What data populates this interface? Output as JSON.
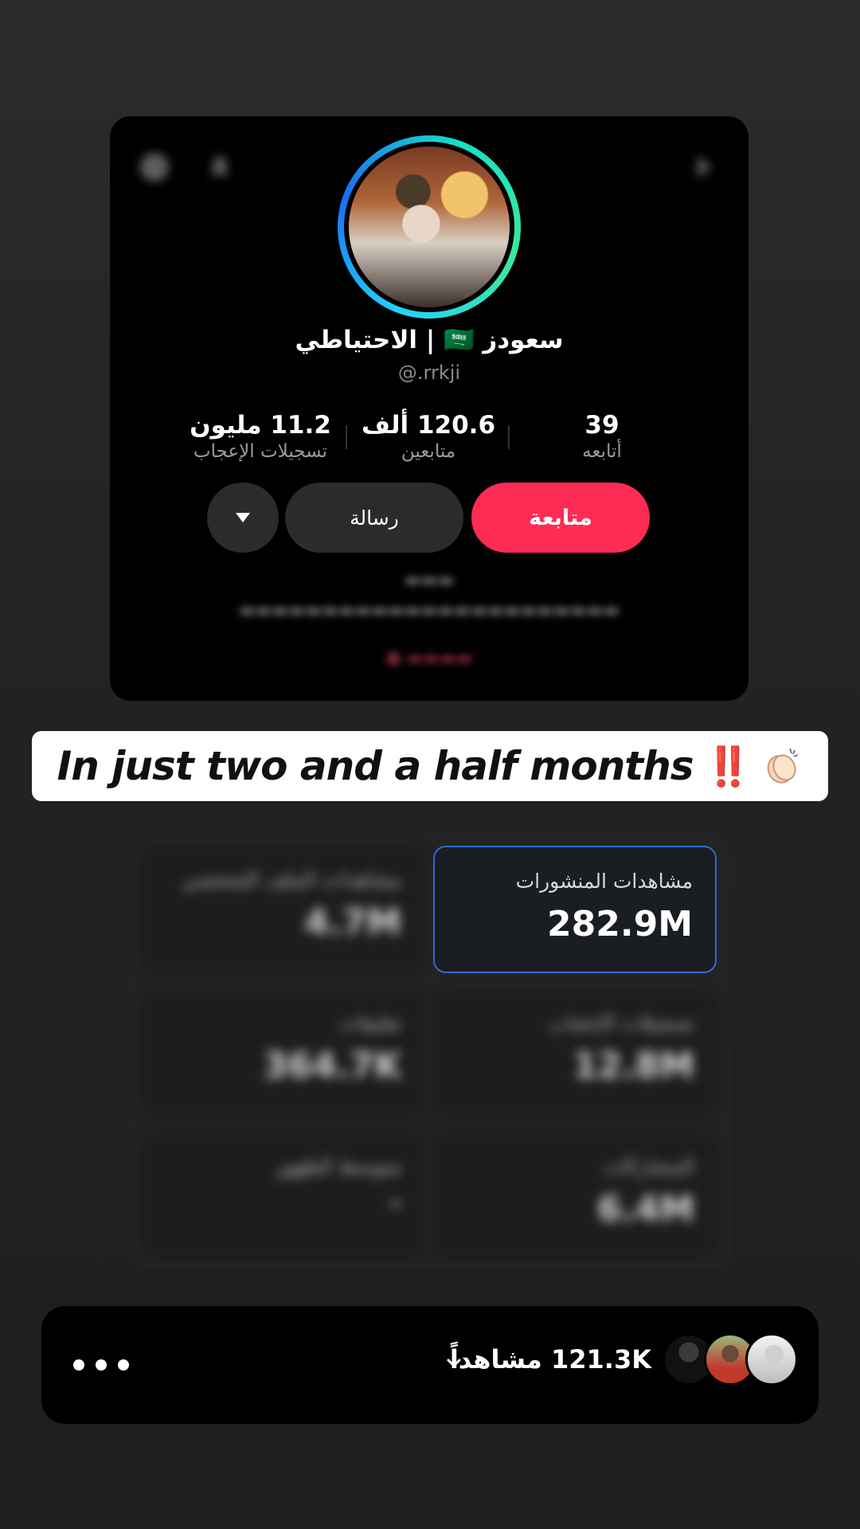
{
  "profile": {
    "display_name": "سعودز 🇸🇦 | الاحتياطي",
    "handle": "@.rrkji",
    "stats": [
      {
        "value": "39",
        "label": "أتابعه"
      },
      {
        "value": "120.6 ألف",
        "label": "متابعين"
      },
      {
        "value": "11.2 مليون",
        "label": "تسجيلات الإعجاب"
      }
    ],
    "follow_label": "متابعة",
    "message_label": "رسالة"
  },
  "caption": {
    "text": "In just two and a half months",
    "emoji": "‼️"
  },
  "analytics": {
    "featured": {
      "label": "مشاهدات المنشورات",
      "value": "282.9M"
    },
    "blurred": [
      {
        "label": "مشاهدات الملف الشخصي",
        "value": "4.7M"
      },
      {
        "label": "تسجيلات الإعجاب",
        "value": "12.8M"
      },
      {
        "label": "تعليقات",
        "value": "364.7K"
      },
      {
        "label": "المشاركات",
        "value": "6.4M"
      },
      {
        "label": "متوسط الظهور",
        "value": "–"
      }
    ]
  },
  "viewers": {
    "count_text": "121.3K مشاهداً"
  },
  "colors": {
    "follow": "#fe2c55",
    "featured_border": "#2e6bd6",
    "ring_start": "#21d4fd",
    "ring_end": "#3ce89b"
  }
}
